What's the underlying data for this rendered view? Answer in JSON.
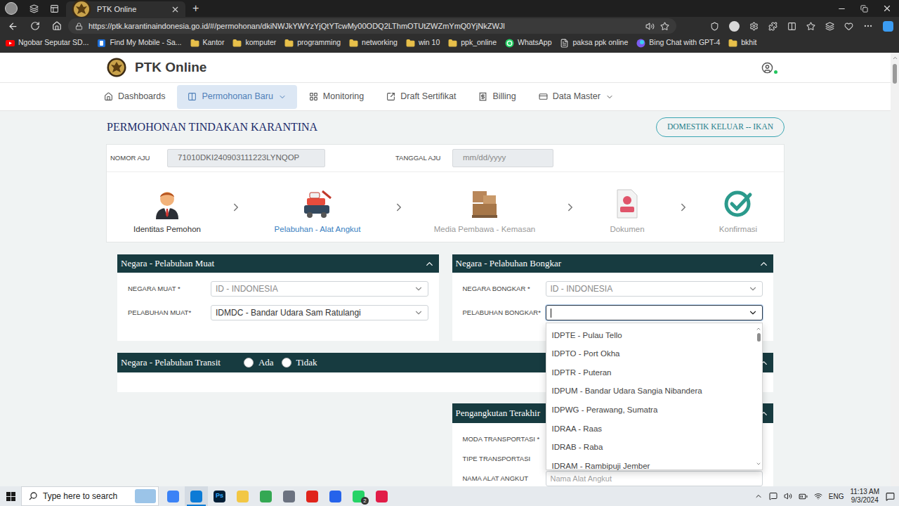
{
  "browser": {
    "tabs": [
      {
        "title": "PTK Online",
        "selected": true
      }
    ],
    "new_tab": "+",
    "url": "https://ptk.karantinaindonesia.go.id/#/permohonan/dkiNWJkYWYzYjQtYTcwMy00ODQ2LThmOTUtZWZmYmQ0YjNkZWJl",
    "bookmarks": [
      {
        "label": "Ngobar Seputar SD...",
        "kind": "youtube"
      },
      {
        "label": "Find My Mobile - Sa...",
        "kind": "site"
      },
      {
        "label": "Kantor",
        "kind": "folder"
      },
      {
        "label": "komputer",
        "kind": "folder"
      },
      {
        "label": "programming",
        "kind": "folder"
      },
      {
        "label": "networking",
        "kind": "folder"
      },
      {
        "label": "win 10",
        "kind": "folder"
      },
      {
        "label": "ppk_online",
        "kind": "folder"
      },
      {
        "label": "WhatsApp",
        "kind": "whatsapp"
      },
      {
        "label": "paksa ppk online",
        "kind": "page"
      },
      {
        "label": "Bing Chat with GPT-4",
        "kind": "bing"
      },
      {
        "label": "bkhit",
        "kind": "folder"
      }
    ]
  },
  "app": {
    "title": "PTK Online",
    "user_online": true,
    "nav": [
      {
        "label": "Dashboards",
        "selected": false,
        "dropdown": false
      },
      {
        "label": "Permohonan Baru",
        "selected": true,
        "dropdown": true
      },
      {
        "label": "Monitoring",
        "selected": false,
        "dropdown": false
      },
      {
        "label": "Draft Sertifikat",
        "selected": false,
        "dropdown": false
      },
      {
        "label": "Billing",
        "selected": false,
        "dropdown": false
      },
      {
        "label": "Data Master",
        "selected": false,
        "dropdown": true
      }
    ]
  },
  "page": {
    "title": "PERMOHONAN TINDAKAN KARANTINA",
    "badge": "DOMESTIK KELUAR -- IKAN",
    "fields": [
      {
        "label": "NOMOR AJU",
        "value": "71010DKI240903111223LYNQOP",
        "placeholder": ""
      },
      {
        "label": "TANGGAL AJU",
        "value": "",
        "placeholder": "mm/dd/yyyy"
      }
    ],
    "steps": [
      {
        "label": "Identitas Pemohon",
        "status": "done"
      },
      {
        "label": "Pelabuhan - Alat Angkut",
        "status": "active"
      },
      {
        "label": "Media Pembawa - Kemasan",
        "status": "pending"
      },
      {
        "label": "Dokumen",
        "status": "pending"
      },
      {
        "label": "Konfirmasi",
        "status": "pending"
      }
    ],
    "muat": {
      "title": "Negara - Pelabuhan Muat",
      "expanded": true,
      "fields": [
        {
          "label": "NEGARA MUAT *",
          "value": "ID - INDONESIA",
          "placeholder": "",
          "kind": "select",
          "disabled": true,
          "focused": false
        },
        {
          "label": "PELABUHAN MUAT*",
          "value": "IDMDC - Bandar Udara Sam Ratulangi",
          "placeholder": "",
          "kind": "select",
          "disabled": false,
          "focused": false
        }
      ]
    },
    "bongkar": {
      "title": "Negara - Pelabuhan Bongkar",
      "expanded": true,
      "fields": [
        {
          "label": "NEGARA BONGKAR *",
          "value": "ID - INDONESIA",
          "placeholder": "",
          "kind": "select",
          "disabled": true,
          "focused": false
        },
        {
          "label": "PELABUHAN BONGKAR*",
          "value": "",
          "placeholder": "",
          "kind": "select",
          "disabled": false,
          "focused": true
        }
      ],
      "dropdown": {
        "open": true,
        "options": [
          "IDPTE - Pulau Tello",
          "IDPTO - Port Okha",
          "IDPTR - Puteran",
          "IDPUM - Bandar Udara Sangia Nibandera",
          "IDPWG - Perawang, Sumatra",
          "IDRAA - Raas",
          "IDRAB - Raba",
          "IDRAM - Rambipuji Jember"
        ]
      }
    },
    "transit": {
      "title": "Negara - Pelabuhan Transit",
      "expanded": true,
      "options": [
        {
          "label": "Ada",
          "selected": false
        },
        {
          "label": "Tidak",
          "selected": false
        }
      ]
    },
    "pengangkutan": {
      "title": "Pengangkutan Terakhir",
      "expanded": true,
      "fields": [
        {
          "label": "MODA TRANSPORTASI *",
          "value": "",
          "placeholder": "",
          "kind": "select",
          "disabled": false,
          "focused": false
        },
        {
          "label": "TIPE TRANSPORTASI",
          "value": "",
          "placeholder": "",
          "kind": "select",
          "disabled": false,
          "focused": false
        },
        {
          "label": "NAMA ALAT ANGKUT",
          "value": "",
          "placeholder": "Nama Alat Angkut",
          "kind": "input",
          "disabled": false,
          "focused": false
        }
      ]
    }
  },
  "taskbar": {
    "search": "Type here to search",
    "apps": [
      {
        "label": "",
        "active": false,
        "badge": ""
      },
      {
        "label": "",
        "active": true,
        "badge": ""
      },
      {
        "label": "Ps",
        "active": false,
        "badge": ""
      },
      {
        "label": "",
        "active": false,
        "badge": ""
      },
      {
        "label": "",
        "active": false,
        "badge": ""
      },
      {
        "label": "",
        "active": false,
        "badge": ""
      },
      {
        "label": "",
        "active": false,
        "badge": ""
      },
      {
        "label": "",
        "active": false,
        "badge": ""
      },
      {
        "label": "",
        "active": false,
        "badge": "2"
      },
      {
        "label": "",
        "active": false,
        "badge": ""
      }
    ],
    "language": "ENG",
    "time": "11:13 AM",
    "date": "9/3/2024"
  }
}
